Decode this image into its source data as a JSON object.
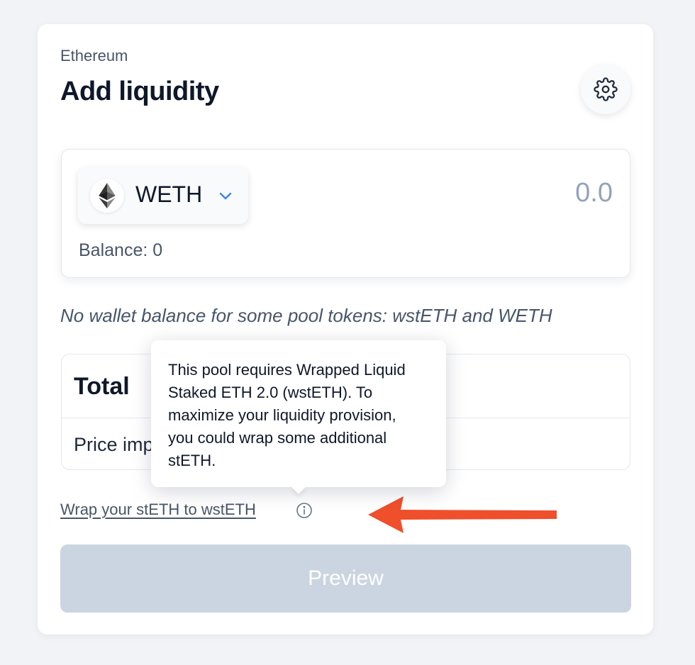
{
  "header": {
    "network": "Ethereum",
    "title": "Add liquidity"
  },
  "token_input": {
    "symbol": "WETH",
    "placeholder": "0.0",
    "balance_label": "Balance: 0"
  },
  "warning": "No wallet balance for some pool tokens: wstETH and WETH",
  "summary": {
    "total_label": "Total",
    "price_impact_label": "Price imp"
  },
  "tooltip": {
    "text": "This pool requires Wrapped Liquid Staked ETH 2.0 (wstETH). To maximize your liquidity provision, you could wrap some additional stETH."
  },
  "wrap_link": "Wrap your stETH to wstETH",
  "preview_button": "Preview",
  "icons": {
    "settings": "gear-icon",
    "token": "ethereum-icon",
    "dropdown": "chevron-down-icon",
    "info": "info-icon",
    "annotation": "red-arrow"
  },
  "colors": {
    "accent": "#3b82f6",
    "annotation": "#ef4f2b",
    "disabled_button": "#cbd5e1"
  }
}
